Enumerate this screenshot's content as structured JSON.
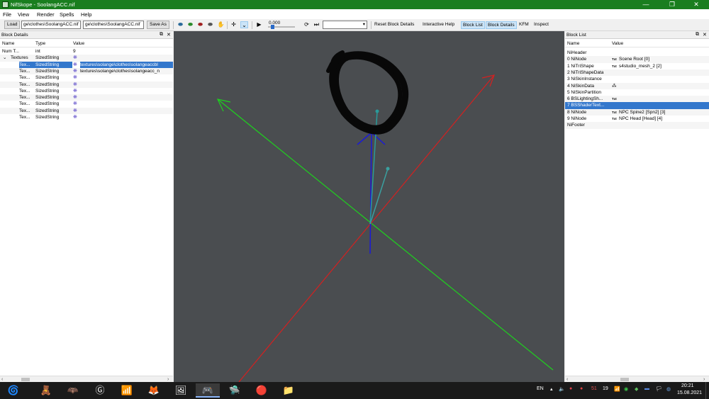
{
  "window": {
    "title": "NifSkope - SoolangACC.nif",
    "min": "—",
    "max": "❐",
    "close": "✕"
  },
  "menu": [
    "File",
    "View",
    "Render",
    "Spells",
    "Help"
  ],
  "toolbar": {
    "load": "Load",
    "load_path": "ge\\clothes\\SoolangACC.nif",
    "save_path": "ge\\clothes\\SoolangACC.nif",
    "save_as": "Save As",
    "time_value": "0.000",
    "reset_block_details": "Reset Block Details",
    "interactive_help": "Interactive Help",
    "block_list": "Block List",
    "block_details": "Block Details",
    "kfm": "KFM",
    "inspect": "Inspect"
  },
  "block_details": {
    "title": "Block Details",
    "columns": [
      "Name",
      "Type",
      "Value"
    ],
    "rows": [
      {
        "expander": "",
        "name": "Num T...",
        "type": "int",
        "value": "9",
        "icon": false
      },
      {
        "expander": "⌄",
        "name": "Textures",
        "type": "SizedString",
        "value": "",
        "icon": true
      },
      {
        "expander": "",
        "name": "Tex...",
        "type": "SizedString",
        "value": "textures\\solange\\clothes\\solangeaccbl",
        "icon": true
      },
      {
        "expander": "",
        "name": "Tex...",
        "type": "SizedString",
        "value": "textures\\solange\\clothes\\solangeacc_n",
        "icon": true
      },
      {
        "expander": "",
        "name": "Tex...",
        "type": "SizedString",
        "value": "",
        "icon": true
      },
      {
        "expander": "",
        "name": "Tex...",
        "type": "SizedString",
        "value": "",
        "icon": true
      },
      {
        "expander": "",
        "name": "Tex...",
        "type": "SizedString",
        "value": "",
        "icon": true
      },
      {
        "expander": "",
        "name": "Tex...",
        "type": "SizedString",
        "value": "",
        "icon": true
      },
      {
        "expander": "",
        "name": "Tex...",
        "type": "SizedString",
        "value": "",
        "icon": true
      },
      {
        "expander": "",
        "name": "Tex...",
        "type": "SizedString",
        "value": "",
        "icon": true
      },
      {
        "expander": "",
        "name": "Tex...",
        "type": "SizedString",
        "value": "",
        "icon": true
      }
    ]
  },
  "block_list": {
    "title": "Block List",
    "columns": [
      "Name",
      "Value"
    ],
    "rows": [
      {
        "name": "NiHeader",
        "value": "",
        "txt": false
      },
      {
        "name": "0 NiNode",
        "value": "Scene Root [0]",
        "txt": true
      },
      {
        "name": "1 NiTriShape",
        "value": "s4studio_mesh_2 [2]",
        "txt": true
      },
      {
        "name": "2 NiTriShapeData",
        "value": "",
        "txt": false
      },
      {
        "name": "3 NiSkinInstance",
        "value": "",
        "txt": false
      },
      {
        "name": "4 NiSkinData",
        "value": "⁂",
        "txt": false
      },
      {
        "name": "5 NiSkinPartition",
        "value": "",
        "txt": false
      },
      {
        "name": "6 BSLightingSh...",
        "value": "",
        "txt": true
      },
      {
        "name": "7 BSShaderText...",
        "value": "",
        "txt": false
      },
      {
        "name": "8 NiNode",
        "value": "NPC Spine2 [Spn2] [3]",
        "txt": true
      },
      {
        "name": "9 NiNode",
        "value": "NPC Head [Head] [4]",
        "txt": true
      },
      {
        "name": "NiFooter",
        "value": "",
        "txt": false
      }
    ]
  },
  "txt_badge": "Txt",
  "taskbar": {
    "apps": [
      "🌀",
      "🧸",
      "🦇",
      "Ⓖ",
      "📶",
      "🦊",
      "🖼",
      "🎮",
      "🛸",
      "🔴",
      "📁"
    ],
    "lang": "EN",
    "tray_nums": [
      "51",
      "19"
    ],
    "time": "20:21",
    "date": "15.08.2021"
  },
  "colors": {
    "titlebar": "#1a7e1f",
    "viewport": "#4a4d50",
    "selection": "#3377cc"
  }
}
